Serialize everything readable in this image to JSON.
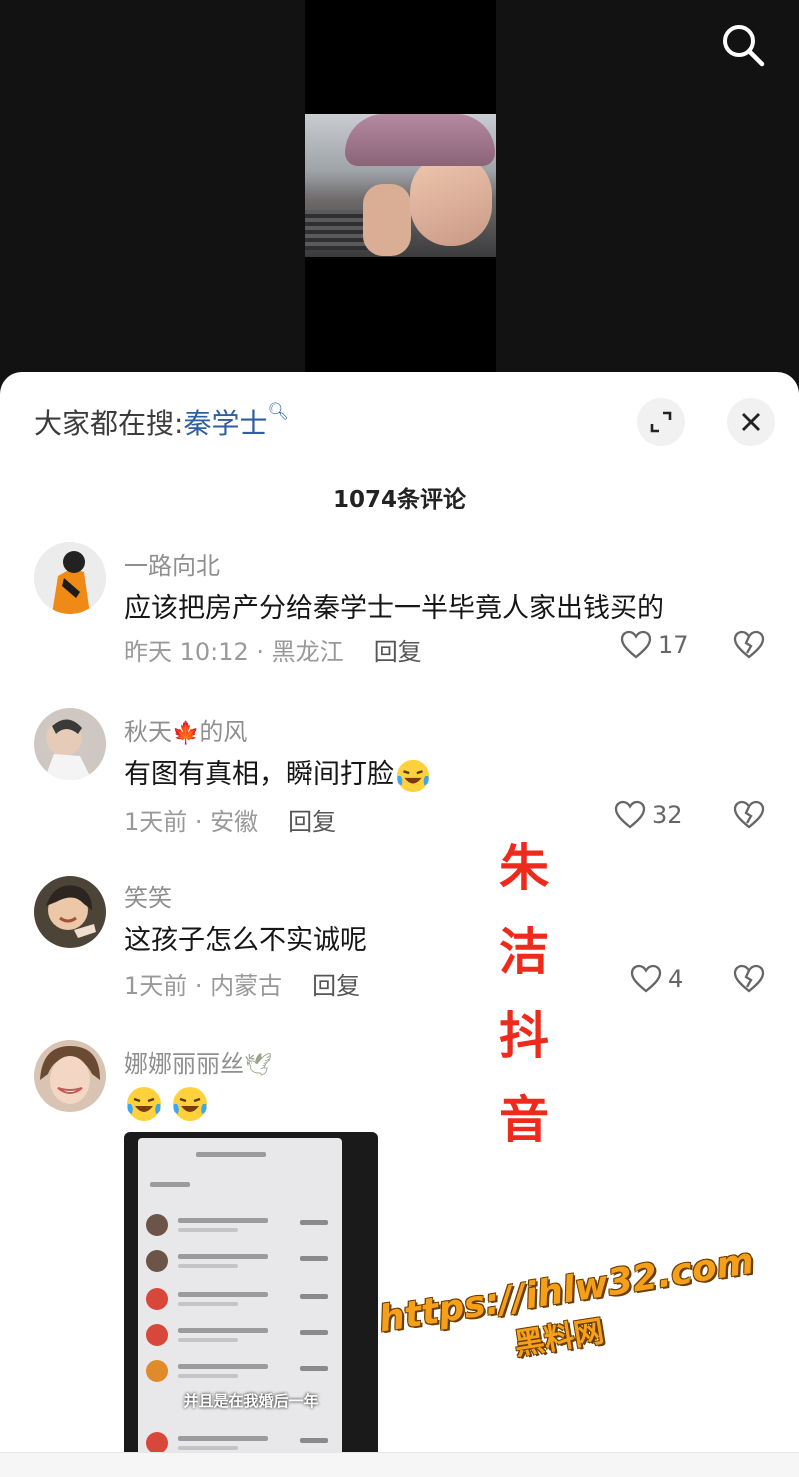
{
  "header": {
    "search_icon": "search-icon"
  },
  "sheet": {
    "hot_search_prefix": "大家都在搜:",
    "hot_search_keyword": "秦学士",
    "expand_icon": "expand-icon",
    "close_icon": "close-icon",
    "comment_count": "1074条评论"
  },
  "comments": [
    {
      "user": "一路向北",
      "text": "应该把房产分给秦学士一半毕竟人家出钱买的",
      "time_location": "昨天 10:12 · 黑龙江",
      "reply": "回复",
      "likes": "17"
    },
    {
      "user": "秋天",
      "user_suffix": "的风",
      "user_emoji": "maple-leaf-icon",
      "text": "有图有真相，瞬间打脸",
      "text_emoji": "laughing-tears-emoji",
      "time_location": "1天前 · 安徽",
      "reply": "回复",
      "likes": "32"
    },
    {
      "user": "笑笑",
      "text": "这孩子怎么不实诚呢",
      "time_location": "1天前 · 内蒙古",
      "reply": "回复",
      "likes": "4"
    },
    {
      "user": "娜娜丽丽丝",
      "user_emoji": "dove-icon",
      "text_emoji": "laughing-tears-emoji",
      "image_caption": "并且是在我婚后一年"
    }
  ],
  "watermarks": {
    "vertical": [
      "朱",
      "洁",
      "抖",
      "音"
    ],
    "url": "https://ihlw32.com",
    "site": "黑料网"
  },
  "colors": {
    "keyword_blue": "#2f5f9e",
    "watermark_red": "#ee2a1c",
    "watermark_orange": "#f5a018"
  }
}
